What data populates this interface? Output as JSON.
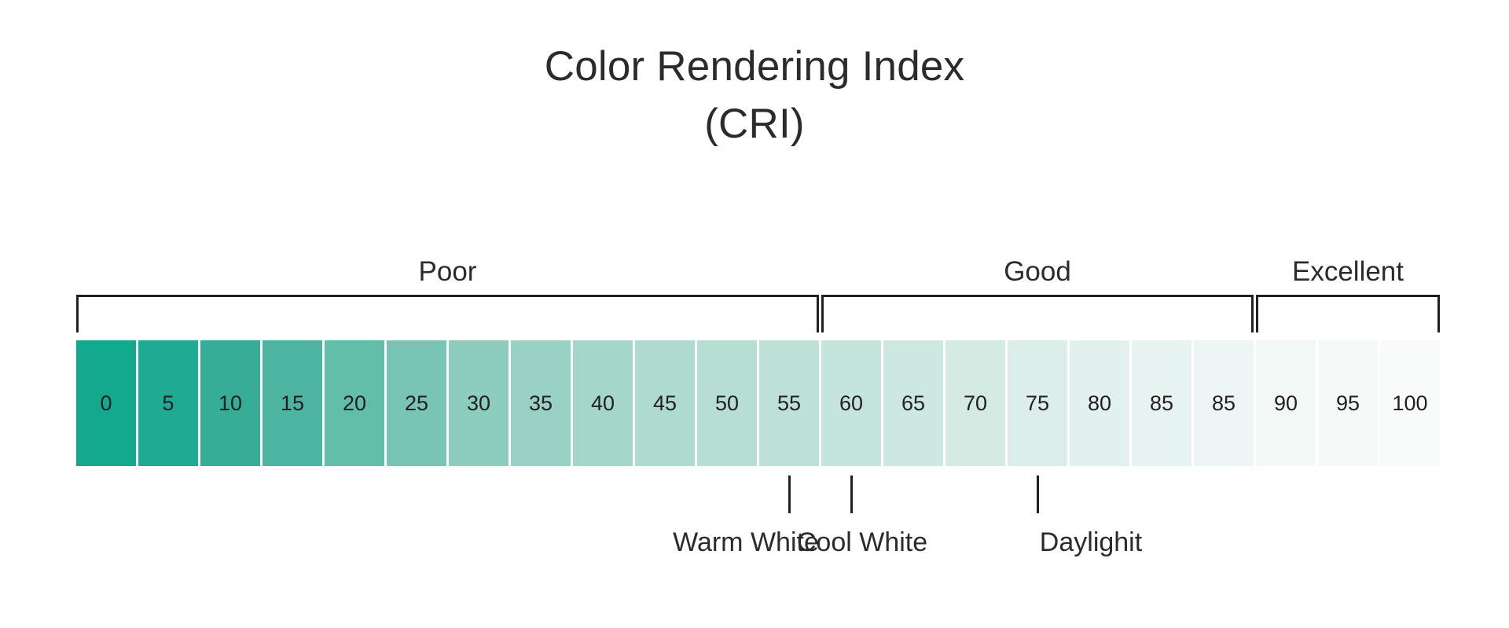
{
  "title": {
    "line1": "Color Rendering Index",
    "line2": "(CRI)"
  },
  "chart_data": {
    "type": "heatmap",
    "title": "Color Rendering Index (CRI)",
    "xlabel": "",
    "ylabel": "",
    "grid": false,
    "legend_position": "none",
    "scale_description": "Horizontal CRI gradient scale from 0 (poor color rendering, saturated teal) to 100 (excellent color rendering, near white).",
    "categories": [
      "0",
      "5",
      "10",
      "15",
      "20",
      "25",
      "30",
      "35",
      "40",
      "45",
      "50",
      "55",
      "60",
      "65",
      "70",
      "75",
      "80",
      "85",
      "85",
      "90",
      "95",
      "100"
    ],
    "values": [
      0,
      5,
      10,
      15,
      20,
      25,
      30,
      35,
      40,
      45,
      50,
      55,
      60,
      65,
      70,
      75,
      80,
      85,
      85,
      90,
      95,
      100
    ],
    "xlim": [
      0,
      100
    ],
    "colors": [
      "#12a98f",
      "#1fab93",
      "#37ad98",
      "#4cb4a1",
      "#63bdab",
      "#79c5b5",
      "#8ccdbe",
      "#99d1c4",
      "#a5d6ca",
      "#aedacf",
      "#b6ded3",
      "#bde1d7",
      "#c5e5dc",
      "#cce8e0",
      "#d4ebe4",
      "#dbeeea",
      "#e2f1ed",
      "#e7f3f0",
      "#edf6f4",
      "#f2f8f6",
      "#f5faf9",
      "#f8fbfa"
    ],
    "brackets": [
      {
        "label": "Poor",
        "start_index": 0,
        "end_index": 11
      },
      {
        "label": "Good",
        "start_index": 12,
        "end_index": 18
      },
      {
        "label": "Excellent",
        "start_index": 19,
        "end_index": 21
      }
    ],
    "annotations": [
      {
        "label": "Warm White",
        "value": 55
      },
      {
        "label": "Cool White",
        "value": 60
      },
      {
        "label": "Daylighit",
        "value": 75
      }
    ]
  },
  "colors": {
    "scale_start": "#12a98f",
    "scale_end": "#f8fbfa",
    "ink": "#231f20",
    "background": "#ffffff"
  }
}
